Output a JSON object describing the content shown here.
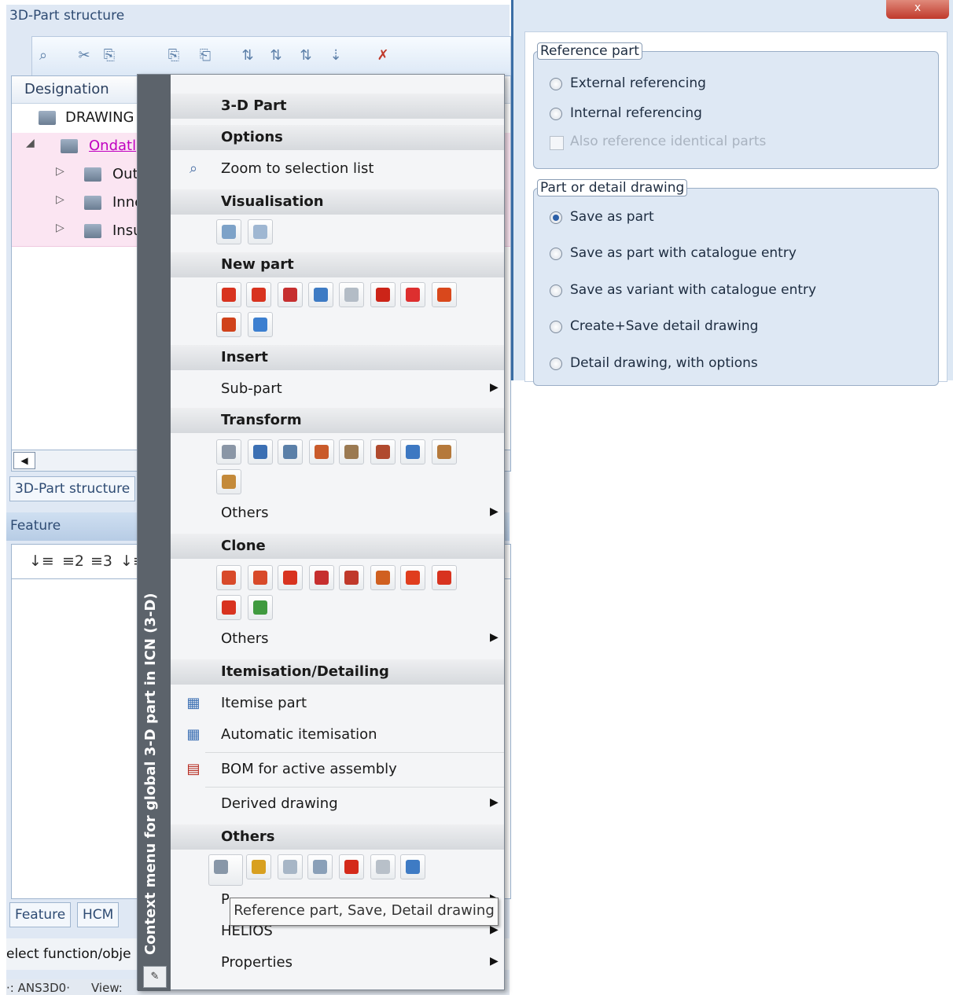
{
  "left_panel": {
    "title": "3D-Part structure",
    "tree": {
      "header": "Designation",
      "rows": [
        {
          "label": "DRAWING"
        },
        {
          "label": "Ondatl"
        },
        {
          "label": "Out"
        },
        {
          "label": "Inne"
        },
        {
          "label": "Insu"
        }
      ]
    },
    "tab": "3D-Part structure",
    "feature": {
      "title": "Feature",
      "tools": [
        "↓≡",
        "≡2",
        "≡3",
        "↓≡"
      ]
    },
    "bottom_tabs": [
      "Feature",
      "HCM"
    ],
    "status": "elect function/obje",
    "bottom_status": [
      "·: ANS3D0·",
      "View:"
    ]
  },
  "dialog": {
    "close_label": "x",
    "reference_part": {
      "title": "Reference part",
      "options": [
        "External referencing",
        "Internal referencing"
      ],
      "checkbox": "Also reference identical parts"
    },
    "part_or_detail": {
      "title": "Part or detail drawing",
      "selected_index": 0,
      "options": [
        "Save as part",
        "Save as part with catalogue entry",
        "Save as variant with catalogue entry",
        "Create+Save detail drawing",
        "Detail drawing, with options"
      ]
    }
  },
  "context_menu": {
    "vertical_title": "Context menu for global 3-D part in ICN (3-D)",
    "sections": {
      "part": "3-D Part",
      "options": "Options",
      "visualisation": "Visualisation",
      "new_part": "New part",
      "insert": "Insert",
      "transform": "Transform",
      "clone": "Clone",
      "itemisation": "Itemisation/Detailing",
      "others": "Others"
    },
    "items": {
      "zoom": "Zoom to selection list",
      "sub_part": "Sub-part",
      "transform_others": "Others",
      "clone_others": "Others",
      "itemise": "Itemise part",
      "auto_itemise": "Automatic itemisation",
      "bom": "BOM for active assembly",
      "derived": "Derived drawing",
      "part_partial": "P",
      "helios": "HELIOS",
      "properties": "Properties"
    },
    "tooltip": "Reference part, Save, Detail drawing"
  }
}
